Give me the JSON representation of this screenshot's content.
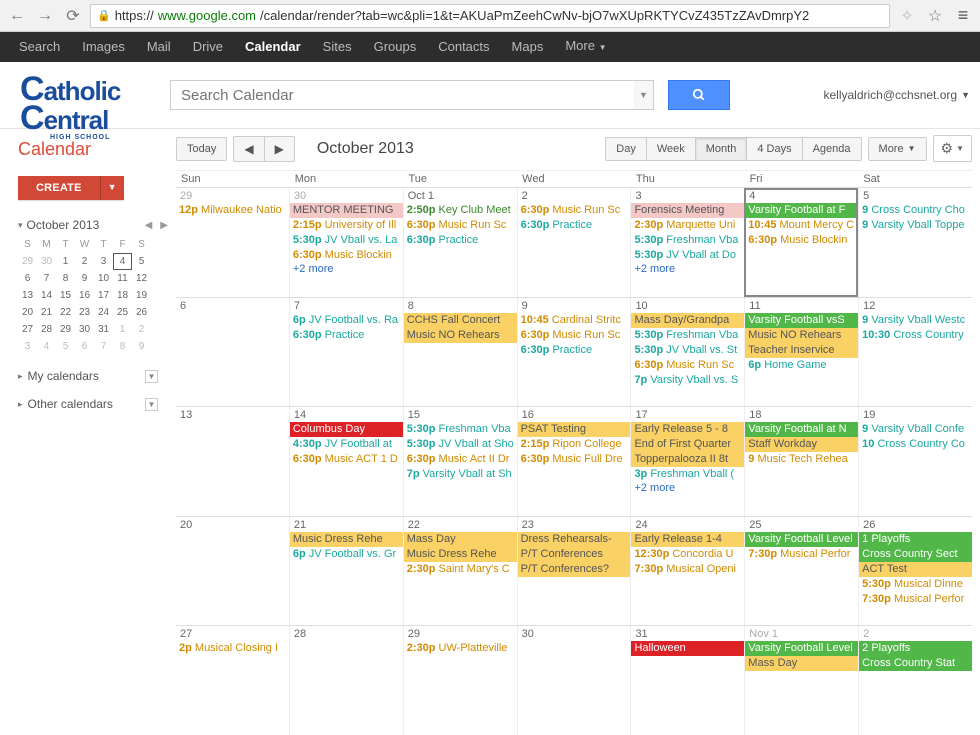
{
  "browser": {
    "url_prefix": "https://",
    "url_domain": "www.google.com",
    "url_path": "/calendar/render?tab=wc&pli=1&t=AKUaPmZeehCwNv-bjO7wXUpRKTYCvZ435TzZAvDmrpY2"
  },
  "black_nav": {
    "items": [
      "Search",
      "Images",
      "Mail",
      "Drive",
      "Calendar",
      "Sites",
      "Groups",
      "Contacts",
      "Maps",
      "More"
    ],
    "active": "Calendar"
  },
  "header": {
    "logo_line1": "atholic",
    "logo_line2": "entral",
    "logo_sub": "HIGH SCHOOL",
    "search_placeholder": "Search Calendar",
    "user_email": "kellyaldrich@cchsnet.org"
  },
  "sidebar": {
    "title": "Calendar",
    "create_label": "CREATE",
    "month_label": "October 2013",
    "dow": [
      "S",
      "M",
      "T",
      "W",
      "T",
      "F",
      "S"
    ],
    "mini_weeks": [
      [
        {
          "d": "29",
          "dim": true
        },
        {
          "d": "30",
          "dim": true
        },
        {
          "d": "1"
        },
        {
          "d": "2"
        },
        {
          "d": "3"
        },
        {
          "d": "4",
          "today": true
        },
        {
          "d": "5"
        }
      ],
      [
        {
          "d": "6"
        },
        {
          "d": "7"
        },
        {
          "d": "8"
        },
        {
          "d": "9"
        },
        {
          "d": "10"
        },
        {
          "d": "11"
        },
        {
          "d": "12"
        }
      ],
      [
        {
          "d": "13"
        },
        {
          "d": "14"
        },
        {
          "d": "15"
        },
        {
          "d": "16"
        },
        {
          "d": "17"
        },
        {
          "d": "18"
        },
        {
          "d": "19"
        }
      ],
      [
        {
          "d": "20"
        },
        {
          "d": "21"
        },
        {
          "d": "22"
        },
        {
          "d": "23"
        },
        {
          "d": "24"
        },
        {
          "d": "25"
        },
        {
          "d": "26"
        }
      ],
      [
        {
          "d": "27"
        },
        {
          "d": "28"
        },
        {
          "d": "29"
        },
        {
          "d": "30"
        },
        {
          "d": "31"
        },
        {
          "d": "1",
          "dim": true
        },
        {
          "d": "2",
          "dim": true
        }
      ],
      [
        {
          "d": "3",
          "dim": true
        },
        {
          "d": "4",
          "dim": true
        },
        {
          "d": "5",
          "dim": true
        },
        {
          "d": "6",
          "dim": true
        },
        {
          "d": "7",
          "dim": true
        },
        {
          "d": "8",
          "dim": true
        },
        {
          "d": "9",
          "dim": true
        }
      ]
    ],
    "sections": [
      "My calendars",
      "Other calendars"
    ]
  },
  "toolbar": {
    "today": "Today",
    "month_label": "October 2013",
    "views": [
      "Day",
      "Week",
      "Month",
      "4 Days",
      "Agenda"
    ],
    "active_view": "Month",
    "more": "More"
  },
  "day_headers": [
    "Sun",
    "Mon",
    "Tue",
    "Wed",
    "Thu",
    "Fri",
    "Sat"
  ],
  "weeks": [
    [
      {
        "num": "29",
        "dim": true,
        "events": [
          {
            "t": "12p",
            "txt": "Milwaukee Natio",
            "cls": "evt-orange"
          }
        ]
      },
      {
        "num": "30",
        "dim": true,
        "events": [
          {
            "txt": "MENTOR MEETING",
            "cls": "evt-band-pink"
          },
          {
            "t": "2:15p",
            "txt": "University of Ill",
            "cls": "evt-orange"
          },
          {
            "t": "5:30p",
            "txt": "JV Vball vs. La",
            "cls": "evt-teal"
          },
          {
            "t": "6:30p",
            "txt": "Music Blockin",
            "cls": "evt-orange"
          }
        ],
        "more": "+2 more"
      },
      {
        "num": "Oct 1",
        "events": [
          {
            "t": "2:50p",
            "txt": "Key Club Meet",
            "cls": "evt-green"
          },
          {
            "t": "6:30p",
            "txt": "Music Run Sc",
            "cls": "evt-orange"
          },
          {
            "t": "6:30p",
            "txt": "Practice",
            "cls": "evt-teal"
          }
        ]
      },
      {
        "num": "2",
        "events": [
          {
            "t": "6:30p",
            "txt": "Music Run Sc",
            "cls": "evt-orange"
          },
          {
            "t": "6:30p",
            "txt": "Practice",
            "cls": "evt-teal"
          }
        ]
      },
      {
        "num": "3",
        "events": [
          {
            "txt": "Forensics Meeting",
            "cls": "evt-band-pink"
          },
          {
            "t": "2:30p",
            "txt": "Marquette Uni",
            "cls": "evt-orange"
          },
          {
            "t": "5:30p",
            "txt": "Freshman Vba",
            "cls": "evt-teal"
          },
          {
            "t": "5:30p",
            "txt": "JV Vball at Do",
            "cls": "evt-teal"
          }
        ],
        "more": "+2 more"
      },
      {
        "num": "4",
        "selected": true,
        "events": [
          {
            "txt": "Varsity Football at F",
            "cls": "evt-band-green"
          },
          {
            "t": "10:45",
            "txt": "Mount Mercy C",
            "cls": "evt-orange"
          },
          {
            "t": "6:30p",
            "txt": "Music Blockin",
            "cls": "evt-orange"
          }
        ]
      },
      {
        "num": "5",
        "events": [
          {
            "t": "9",
            "txt": "Cross Country Cho",
            "cls": "evt-teal"
          },
          {
            "t": "9",
            "txt": "Varsity Vball Toppe",
            "cls": "evt-teal"
          }
        ]
      }
    ],
    [
      {
        "num": "6",
        "events": []
      },
      {
        "num": "7",
        "events": [
          {
            "t": "6p",
            "txt": "JV Football vs. Ra",
            "cls": "evt-teal"
          },
          {
            "t": "6:30p",
            "txt": "Practice",
            "cls": "evt-teal"
          }
        ]
      },
      {
        "num": "8",
        "events": [
          {
            "txt": "CCHS Fall Concert",
            "cls": "evt-band-yellow"
          },
          {
            "txt": "Music NO Rehears",
            "cls": "evt-band-yellow"
          }
        ]
      },
      {
        "num": "9",
        "events": [
          {
            "t": "10:45",
            "txt": "Cardinal Stritc",
            "cls": "evt-orange"
          },
          {
            "t": "6:30p",
            "txt": "Music Run Sc",
            "cls": "evt-orange"
          },
          {
            "t": "6:30p",
            "txt": "Practice",
            "cls": "evt-teal"
          }
        ]
      },
      {
        "num": "10",
        "events": [
          {
            "txt": "Mass Day/Grandpa",
            "cls": "evt-band-yellow"
          },
          {
            "t": "5:30p",
            "txt": "Freshman Vba",
            "cls": "evt-teal"
          },
          {
            "t": "5:30p",
            "txt": "JV Vball vs. St",
            "cls": "evt-teal"
          },
          {
            "t": "6:30p",
            "txt": "Music Run Sc",
            "cls": "evt-orange"
          },
          {
            "t": "7p",
            "txt": "Varsity Vball vs. S",
            "cls": "evt-teal"
          }
        ]
      },
      {
        "num": "11",
        "events": [
          {
            "txt": "Varsity Football vsS",
            "cls": "evt-band-green"
          },
          {
            "txt": "Music NO Rehears",
            "cls": "evt-band-yellow"
          },
          {
            "txt": "Teacher Inservice",
            "cls": "evt-band-yellow"
          },
          {
            "t": "6p",
            "txt": "Home Game",
            "cls": "evt-teal"
          }
        ]
      },
      {
        "num": "12",
        "events": [
          {
            "t": "9",
            "txt": "Varsity Vball Westc",
            "cls": "evt-teal"
          },
          {
            "t": "10:30",
            "txt": "Cross Country",
            "cls": "evt-teal"
          }
        ]
      }
    ],
    [
      {
        "num": "13",
        "events": []
      },
      {
        "num": "14",
        "events": [
          {
            "txt": "Columbus Day",
            "cls": "evt-band-red"
          },
          {
            "t": "4:30p",
            "txt": "JV Football at",
            "cls": "evt-teal"
          },
          {
            "t": "6:30p",
            "txt": "Music ACT 1 D",
            "cls": "evt-orange"
          }
        ]
      },
      {
        "num": "15",
        "events": [
          {
            "t": "5:30p",
            "txt": "Freshman Vba",
            "cls": "evt-teal"
          },
          {
            "t": "5:30p",
            "txt": "JV Vball at Sho",
            "cls": "evt-teal"
          },
          {
            "t": "6:30p",
            "txt": "Music Act II Dr",
            "cls": "evt-orange"
          },
          {
            "t": "7p",
            "txt": "Varsity Vball at Sh",
            "cls": "evt-teal"
          }
        ]
      },
      {
        "num": "16",
        "events": [
          {
            "txt": "PSAT Testing",
            "cls": "evt-band-yellow"
          },
          {
            "t": "2:15p",
            "txt": "Ripon College",
            "cls": "evt-orange"
          },
          {
            "t": "6:30p",
            "txt": "Music Full Dre",
            "cls": "evt-orange"
          }
        ]
      },
      {
        "num": "17",
        "events": [
          {
            "txt": "Early Release 5 - 8",
            "cls": "evt-band-yellow"
          },
          {
            "txt": "End of First Quarter",
            "cls": "evt-band-yellow"
          },
          {
            "txt": "Topperpalooza II 8t",
            "cls": "evt-band-yellow"
          },
          {
            "t": "3p",
            "txt": "Freshman Vball (",
            "cls": "evt-teal"
          }
        ],
        "more": "+2 more"
      },
      {
        "num": "18",
        "events": [
          {
            "txt": "Varsity Football at N",
            "cls": "evt-band-green"
          },
          {
            "txt": "Staff Workday",
            "cls": "evt-band-yellow"
          },
          {
            "t": "9",
            "txt": "Music Tech Rehea",
            "cls": "evt-orange"
          }
        ]
      },
      {
        "num": "19",
        "events": [
          {
            "t": "9",
            "txt": "Varsity Vball Confe",
            "cls": "evt-teal"
          },
          {
            "t": "10",
            "txt": "Cross Country Co",
            "cls": "evt-teal"
          }
        ]
      }
    ],
    [
      {
        "num": "20",
        "events": []
      },
      {
        "num": "21",
        "events": [
          {
            "txt": "Music Dress Rehe",
            "cls": "evt-band-yellow"
          },
          {
            "t": "6p",
            "txt": "JV Football vs. Gr",
            "cls": "evt-teal"
          }
        ]
      },
      {
        "num": "22",
        "events": [
          {
            "txt": "Mass Day",
            "cls": "evt-band-yellow"
          },
          {
            "txt": "Music Dress Rehe",
            "cls": "evt-band-yellow"
          },
          {
            "t": "2:30p",
            "txt": "Saint Mary's C",
            "cls": "evt-orange"
          }
        ]
      },
      {
        "num": "23",
        "events": [
          {
            "txt": "Dress Rehearsals-",
            "cls": "evt-band-yellow"
          },
          {
            "txt": "P/T Conferences",
            "cls": "evt-band-yellow"
          },
          {
            "txt": "P/T Conferences?",
            "cls": "evt-band-yellow"
          }
        ]
      },
      {
        "num": "24",
        "events": [
          {
            "txt": "Early Release 1-4",
            "cls": "evt-band-yellow"
          },
          {
            "t": "12:30p",
            "txt": "Concordia U",
            "cls": "evt-orange"
          },
          {
            "t": "7:30p",
            "txt": "Musical Openi",
            "cls": "evt-orange"
          }
        ]
      },
      {
        "num": "25",
        "events": [
          {
            "txt": "Varsity Football Level",
            "cls": "evt-band-green"
          },
          {
            "t": "7:30p",
            "txt": "Musical Perfor",
            "cls": "evt-orange"
          }
        ]
      },
      {
        "num": "26",
        "events": [
          {
            "txt": "1 Playoffs",
            "cls": "evt-band-green"
          },
          {
            "txt": "Cross Country Sect",
            "cls": "evt-band-green"
          },
          {
            "txt": "ACT Test",
            "cls": "evt-band-yellow"
          },
          {
            "t": "5:30p",
            "txt": "Musical Dinne",
            "cls": "evt-orange"
          },
          {
            "t": "7:30p",
            "txt": "Musical Perfor",
            "cls": "evt-orange"
          }
        ]
      }
    ],
    [
      {
        "num": "27",
        "events": [
          {
            "t": "2p",
            "txt": "Musical Closing I",
            "cls": "evt-orange"
          }
        ]
      },
      {
        "num": "28",
        "events": []
      },
      {
        "num": "29",
        "events": [
          {
            "t": "2:30p",
            "txt": "UW-Platteville",
            "cls": "evt-orange"
          }
        ]
      },
      {
        "num": "30",
        "events": []
      },
      {
        "num": "31",
        "events": [
          {
            "txt": "Halloween",
            "cls": "evt-band-red"
          }
        ]
      },
      {
        "num": "Nov 1",
        "dim": true,
        "events": [
          {
            "txt": "Varsity Football Level",
            "cls": "evt-band-green"
          },
          {
            "txt": "Mass Day",
            "cls": "evt-band-yellow"
          }
        ]
      },
      {
        "num": "2",
        "dim": true,
        "events": [
          {
            "txt": "2 Playoffs",
            "cls": "evt-band-green"
          },
          {
            "txt": "Cross Country Stat",
            "cls": "evt-band-green"
          }
        ]
      }
    ]
  ]
}
